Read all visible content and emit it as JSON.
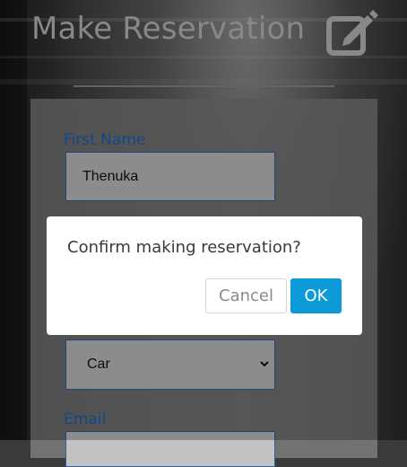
{
  "header": {
    "title": "Make Reservation",
    "icon": "edit-icon"
  },
  "form": {
    "first_name": {
      "label": "First Name",
      "value": "Thenuka"
    },
    "category": {
      "value": "Car",
      "icon": "chevron-down-icon"
    },
    "email": {
      "label": "Email"
    }
  },
  "dialog": {
    "message": "Confirm making reservation?",
    "cancel_label": "Cancel",
    "ok_label": "OK"
  },
  "colors": {
    "accent": "#0d9ad8",
    "label": "#1565c0",
    "title": "#bdbdbd"
  }
}
